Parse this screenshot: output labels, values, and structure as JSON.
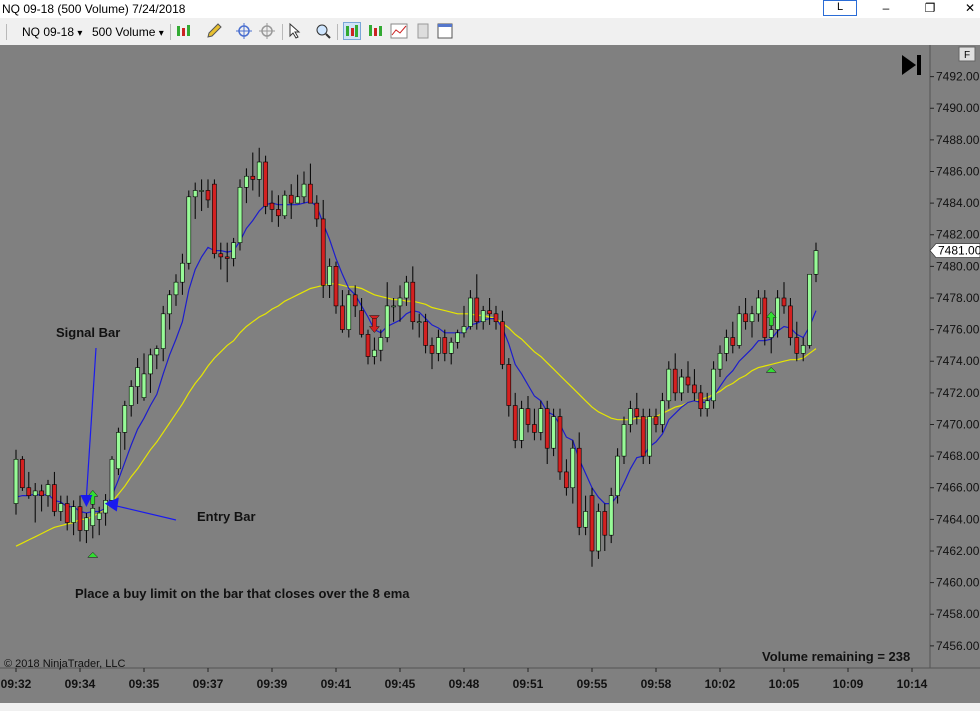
{
  "window": {
    "title": "NQ 09-18 (500 Volume)  7/24/2018",
    "link_label": "L",
    "minimize_glyph": "–",
    "maximize_glyph": "❐",
    "close_glyph": "✕"
  },
  "toolbar": {
    "instrument": "NQ 09-18",
    "interval": "500 Volume",
    "dropdown_glyph": "▾"
  },
  "chart_ui": {
    "f_label": "F",
    "copyright": "© 2018 NinjaTrader, LLC",
    "volume_remaining": "Volume remaining = 238",
    "colors": {
      "background": "#808080",
      "up_bar": "#98fb98",
      "down_bar": "#d42020",
      "ema_fast": "#1c1ccc",
      "ema_slow": "#e6e600",
      "annotation_arrow": "#1a1aee",
      "buy_marker": "#33dd33",
      "sell_marker": "#d42020"
    }
  },
  "chart_data": {
    "type": "candlestick",
    "instrument": "NQ 09-18",
    "interval": "500 Volume",
    "ylim": [
      7454.6,
      7494.0
    ],
    "y_ticks": [
      7456,
      7458,
      7460,
      7462,
      7464,
      7466,
      7468,
      7470,
      7472,
      7474,
      7476,
      7478,
      7480,
      7482,
      7484,
      7486,
      7488,
      7490,
      7492
    ],
    "y_tick_labels": [
      "7456.00",
      "7458.00",
      "7460.00",
      "7462.00",
      "7464.00",
      "7466.00",
      "7468.00",
      "7470.00",
      "7472.00",
      "7474.00",
      "7476.00",
      "7478.00",
      "7480.00",
      "7482.00",
      "7484.00",
      "7486.00",
      "7488.00",
      "7490.00",
      "7492.00"
    ],
    "last_price": 7481.0,
    "last_price_label": "7481.00",
    "x_tick_labels": [
      {
        "bar": 0,
        "label": "09:32"
      },
      {
        "bar": 10,
        "label": "09:34"
      },
      {
        "bar": 20,
        "label": "09:35"
      },
      {
        "bar": 30,
        "label": "09:37"
      },
      {
        "bar": 40,
        "label": "09:39"
      },
      {
        "bar": 50,
        "label": "09:41"
      },
      {
        "bar": 60,
        "label": "09:45"
      },
      {
        "bar": 70,
        "label": "09:48"
      },
      {
        "bar": 80,
        "label": "09:51"
      },
      {
        "bar": 90,
        "label": "09:55"
      },
      {
        "bar": 100,
        "label": "09:58"
      },
      {
        "bar": 110,
        "label": "10:02"
      },
      {
        "bar": 120,
        "label": "10:05"
      },
      {
        "bar": 130,
        "label": "10:09"
      },
      {
        "bar": 140,
        "label": "10:14"
      }
    ],
    "ohlc": [
      [
        7465.0,
        7468.4,
        7464.3,
        7467.8
      ],
      [
        7467.8,
        7468.0,
        7465.8,
        7466.0
      ],
      [
        7466.0,
        7467.0,
        7465.3,
        7465.5
      ],
      [
        7465.5,
        7466.3,
        7463.8,
        7465.8
      ],
      [
        7465.8,
        7466.2,
        7464.5,
        7465.5
      ],
      [
        7465.5,
        7466.5,
        7464.8,
        7466.2
      ],
      [
        7466.2,
        7467.0,
        7464.2,
        7464.5
      ],
      [
        7464.5,
        7465.5,
        7463.9,
        7465.0
      ],
      [
        7465.0,
        7465.5,
        7463.3,
        7463.8
      ],
      [
        7463.8,
        7465.2,
        7463.0,
        7464.8
      ],
      [
        7464.8,
        7465.5,
        7462.6,
        7463.3
      ],
      [
        7463.3,
        7464.4,
        7462.5,
        7464.1
      ],
      [
        7463.6,
        7465.0,
        7462.8,
        7464.7
      ],
      [
        7464.0,
        7464.8,
        7463.0,
        7464.4
      ],
      [
        7464.4,
        7465.6,
        7463.6,
        7465.2
      ],
      [
        7465.2,
        7468.0,
        7465.2,
        7467.8
      ],
      [
        7467.2,
        7469.8,
        7466.8,
        7469.5
      ],
      [
        7469.5,
        7471.5,
        7468.4,
        7471.2
      ],
      [
        7471.2,
        7472.8,
        7470.5,
        7472.4
      ],
      [
        7472.4,
        7474.2,
        7471.3,
        7473.6
      ],
      [
        7471.7,
        7474.5,
        7471.5,
        7473.2
      ],
      [
        7473.2,
        7474.8,
        7472.0,
        7474.4
      ],
      [
        7474.4,
        7475.0,
        7473.5,
        7474.8
      ],
      [
        7474.8,
        7477.5,
        7474.0,
        7477.0
      ],
      [
        7477.0,
        7478.5,
        7476.0,
        7478.2
      ],
      [
        7478.2,
        7479.5,
        7477.5,
        7479.0
      ],
      [
        7479.0,
        7480.8,
        7478.2,
        7480.2
      ],
      [
        7480.2,
        7484.8,
        7479.8,
        7484.4
      ],
      [
        7484.4,
        7485.3,
        7483.0,
        7484.8
      ],
      [
        7484.8,
        7485.5,
        7483.5,
        7484.8
      ],
      [
        7484.8,
        7485.5,
        7483.7,
        7484.2
      ],
      [
        7485.2,
        7485.5,
        7480.5,
        7480.8
      ],
      [
        7480.8,
        7481.5,
        7479.8,
        7480.6
      ],
      [
        7480.6,
        7481.5,
        7479.0,
        7480.5
      ],
      [
        7480.5,
        7481.8,
        7480.0,
        7481.5
      ],
      [
        7481.5,
        7485.5,
        7481.0,
        7485.0
      ],
      [
        7485.0,
        7486.2,
        7484.0,
        7485.7
      ],
      [
        7485.7,
        7487.2,
        7484.8,
        7485.5
      ],
      [
        7485.5,
        7487.5,
        7484.4,
        7486.6
      ],
      [
        7486.6,
        7487.0,
        7483.3,
        7483.8
      ],
      [
        7484.0,
        7484.8,
        7482.8,
        7483.6
      ],
      [
        7483.6,
        7484.5,
        7482.5,
        7483.2
      ],
      [
        7483.2,
        7484.8,
        7483.0,
        7484.5
      ],
      [
        7484.5,
        7485.2,
        7483.0,
        7484.0
      ],
      [
        7484.0,
        7485.8,
        7484.0,
        7484.4
      ],
      [
        7484.4,
        7486.0,
        7484.0,
        7485.2
      ],
      [
        7485.2,
        7486.5,
        7484.5,
        7484.0
      ],
      [
        7484.0,
        7484.5,
        7482.5,
        7483.0
      ],
      [
        7483.0,
        7484.2,
        7478.0,
        7478.8
      ],
      [
        7478.8,
        7480.5,
        7478.0,
        7480.0
      ],
      [
        7480.0,
        7480.3,
        7477.0,
        7477.5
      ],
      [
        7477.5,
        7478.5,
        7475.8,
        7476.0
      ],
      [
        7476.0,
        7478.5,
        7475.5,
        7478.2
      ],
      [
        7478.2,
        7478.8,
        7476.8,
        7477.5
      ],
      [
        7477.2,
        7478.0,
        7475.5,
        7475.7
      ],
      [
        7475.7,
        7476.0,
        7473.8,
        7474.3
      ],
      [
        7474.3,
        7475.5,
        7473.8,
        7474.7
      ],
      [
        7474.7,
        7476.0,
        7474.0,
        7475.5
      ],
      [
        7475.5,
        7479.0,
        7475.2,
        7477.5
      ],
      [
        7477.5,
        7478.0,
        7476.5,
        7477.5
      ],
      [
        7477.5,
        7478.8,
        7476.5,
        7478.0
      ],
      [
        7478.0,
        7479.4,
        7477.5,
        7479.0
      ],
      [
        7479.0,
        7480.0,
        7476.0,
        7476.5
      ],
      [
        7476.5,
        7477.0,
        7475.5,
        7476.5
      ],
      [
        7476.5,
        7477.0,
        7474.5,
        7475.0
      ],
      [
        7475.0,
        7475.5,
        7473.5,
        7474.5
      ],
      [
        7474.5,
        7476.0,
        7474.0,
        7475.5
      ],
      [
        7475.5,
        7476.0,
        7474.0,
        7474.5
      ],
      [
        7474.5,
        7475.5,
        7473.8,
        7475.2
      ],
      [
        7475.2,
        7476.0,
        7474.8,
        7475.8
      ],
      [
        7475.8,
        7477.5,
        7475.5,
        7476.2
      ],
      [
        7476.2,
        7478.5,
        7476.0,
        7478.0
      ],
      [
        7478.0,
        7479.5,
        7476.0,
        7476.5
      ],
      [
        7476.5,
        7477.5,
        7476.0,
        7477.2
      ],
      [
        7477.2,
        7478.0,
        7476.3,
        7477.0
      ],
      [
        7477.0,
        7477.5,
        7476.0,
        7476.5
      ],
      [
        7476.5,
        7477.2,
        7473.5,
        7473.8
      ],
      [
        7473.8,
        7474.2,
        7470.5,
        7471.2
      ],
      [
        7471.2,
        7472.0,
        7468.5,
        7469.0
      ],
      [
        7469.0,
        7471.5,
        7468.5,
        7471.0
      ],
      [
        7471.0,
        7471.8,
        7469.5,
        7470.0
      ],
      [
        7470.0,
        7471.0,
        7469.0,
        7469.5
      ],
      [
        7469.5,
        7471.5,
        7469.0,
        7471.0
      ],
      [
        7471.0,
        7471.5,
        7467.5,
        7468.5
      ],
      [
        7468.5,
        7471.0,
        7468.0,
        7470.5
      ],
      [
        7470.5,
        7471.0,
        7466.5,
        7467.0
      ],
      [
        7467.0,
        7467.8,
        7465.5,
        7466.0
      ],
      [
        7466.0,
        7469.0,
        7465.0,
        7468.5
      ],
      [
        7468.5,
        7469.5,
        7463.0,
        7463.5
      ],
      [
        7463.5,
        7465.5,
        7463.0,
        7464.5
      ],
      [
        7465.5,
        7466.0,
        7461.0,
        7462.0
      ],
      [
        7462.0,
        7465.0,
        7461.5,
        7464.5
      ],
      [
        7464.5,
        7465.0,
        7462.0,
        7463.0
      ],
      [
        7463.0,
        7466.0,
        7462.5,
        7465.5
      ],
      [
        7465.5,
        7468.5,
        7465.0,
        7468.0
      ],
      [
        7468.0,
        7470.5,
        7467.5,
        7470.0
      ],
      [
        7470.0,
        7471.5,
        7469.5,
        7471.0
      ],
      [
        7471.0,
        7472.0,
        7470.0,
        7470.5
      ],
      [
        7470.5,
        7471.0,
        7467.5,
        7468.0
      ],
      [
        7468.0,
        7471.0,
        7467.5,
        7470.5
      ],
      [
        7470.5,
        7471.0,
        7469.5,
        7470.0
      ],
      [
        7470.0,
        7472.0,
        7469.5,
        7471.5
      ],
      [
        7471.5,
        7474.0,
        7471.0,
        7473.5
      ],
      [
        7473.5,
        7474.5,
        7471.5,
        7472.0
      ],
      [
        7472.0,
        7473.5,
        7471.5,
        7473.0
      ],
      [
        7473.0,
        7474.0,
        7472.0,
        7472.5
      ],
      [
        7472.5,
        7473.5,
        7471.5,
        7472.0
      ],
      [
        7472.0,
        7472.5,
        7470.5,
        7471.0
      ],
      [
        7471.0,
        7472.0,
        7470.5,
        7471.5
      ],
      [
        7471.5,
        7474.0,
        7471.0,
        7473.5
      ],
      [
        7473.5,
        7475.0,
        7473.0,
        7474.5
      ],
      [
        7474.5,
        7476.0,
        7474.0,
        7475.5
      ],
      [
        7475.5,
        7476.5,
        7474.5,
        7475.0
      ],
      [
        7475.0,
        7477.5,
        7474.8,
        7477.0
      ],
      [
        7477.0,
        7478.0,
        7476.0,
        7476.5
      ],
      [
        7476.5,
        7477.5,
        7475.5,
        7477.0
      ],
      [
        7477.0,
        7478.5,
        7476.5,
        7478.0
      ],
      [
        7478.0,
        7478.5,
        7475.0,
        7475.5
      ],
      [
        7475.5,
        7476.5,
        7474.5,
        7476.0
      ],
      [
        7476.0,
        7478.5,
        7475.5,
        7478.0
      ],
      [
        7478.0,
        7479.0,
        7477.0,
        7477.5
      ],
      [
        7477.5,
        7478.0,
        7475.0,
        7475.5
      ],
      [
        7475.5,
        7476.5,
        7474.0,
        7474.5
      ],
      [
        7474.5,
        7475.5,
        7474.0,
        7475.0
      ],
      [
        7475.0,
        7479.0,
        7474.8,
        7479.5
      ],
      [
        7479.5,
        7481.5,
        7479.0,
        7481.0
      ]
    ],
    "ema_fast": [
      7465.4,
      7465.5,
      7465.5,
      7465.6,
      7465.5,
      7465.6,
      7465.2,
      7465.1,
      7464.8,
      7464.8,
      7464.5,
      7464.4,
      7464.5,
      7464.5,
      7464.7,
      7465.5,
      7466.5,
      7467.6,
      7468.7,
      7469.7,
      7470.4,
      7471.2,
      7471.9,
      7473.2,
      7474.4,
      7475.4,
      7476.5,
      7478.5,
      7479.8,
      7480.6,
      7481.2,
      7481.0,
      7481.0,
      7480.9,
      7481.0,
      7481.6,
      7482.4,
      7482.9,
      7483.5,
      7483.9,
      7484.0,
      7483.9,
      7483.9,
      7483.9,
      7483.9,
      7484.0,
      7484.1,
      7483.8,
      7482.7,
      7481.7,
      7480.5,
      7479.5,
      7478.6,
      7478.2,
      7477.5,
      7476.8,
      7476.0,
      7475.8,
      7476.2,
      7476.4,
      7476.6,
      7477.0,
      7477.2,
      7477.1,
      7476.7,
      7476.3,
      7476.1,
      7475.8,
      7475.8,
      7475.8,
      7475.8,
      7476.3,
      7476.4,
      7476.6,
      7476.7,
      7476.7,
      7476.1,
      7475.1,
      7473.8,
      7473.2,
      7472.5,
      7471.8,
      7471.5,
      7470.8,
      7470.6,
      7470.0,
      7469.2,
      7469.0,
      7467.8,
      7466.9,
      7466.0,
      7465.4,
      7465.0,
      7465.0,
      7465.5,
      7466.3,
      7467.2,
      7467.9,
      7468.0,
      7468.6,
      7468.9,
      7469.4,
      7470.3,
      7470.7,
      7471.1,
      7471.4,
      7471.5,
      7471.4,
      7471.4,
      7471.8,
      7472.4,
      7473.0,
      7473.4,
      7474.0,
      7474.4,
      7474.8,
      7475.3,
      7475.3,
      7475.4,
      7475.9,
      7476.2,
      7476.1,
      7475.7,
      7475.5,
      7476.2,
      7477.2
    ],
    "ema_slow": [
      7462.3,
      7462.5,
      7462.7,
      7462.9,
      7463.1,
      7463.3,
      7463.5,
      7463.6,
      7463.7,
      7463.8,
      7464.0,
      7464.0,
      7464.2,
      7464.4,
      7464.7,
      7465.1,
      7465.6,
      7466.1,
      7466.7,
      7467.2,
      7467.8,
      7468.4,
      7468.9,
      7469.5,
      7470.1,
      7470.7,
      7471.3,
      7472.0,
      7472.6,
      7473.1,
      7473.7,
      7474.2,
      7474.6,
      7475.0,
      7475.3,
      7475.8,
      7476.2,
      7476.5,
      7476.8,
      7477.0,
      7477.3,
      7477.5,
      7477.8,
      7478.0,
      7478.2,
      7478.4,
      7478.6,
      7478.7,
      7478.8,
      7478.9,
      7478.9,
      7478.8,
      7478.7,
      7478.7,
      7478.6,
      7478.4,
      7478.2,
      7478.1,
      7478.0,
      7477.9,
      7477.9,
      7477.8,
      7477.8,
      7477.7,
      7477.6,
      7477.4,
      7477.3,
      7477.2,
      7477.1,
      7477.0,
      7477.0,
      7477.0,
      7476.9,
      7476.9,
      7476.8,
      7476.7,
      7476.4,
      7476.1,
      7475.7,
      7475.4,
      7475.0,
      7474.6,
      7474.3,
      7473.9,
      7473.5,
      7473.1,
      7472.7,
      7472.3,
      7471.9,
      7471.5,
      7471.1,
      7470.8,
      7470.6,
      7470.4,
      7470.3,
      7470.3,
      7470.3,
      7470.4,
      7470.4,
      7470.4,
      7470.5,
      7470.7,
      7470.9,
      7471.1,
      7471.2,
      7471.4,
      7471.5,
      7471.6,
      7471.7,
      7471.9,
      7472.1,
      7472.4,
      7472.6,
      7472.9,
      7473.1,
      7473.4,
      7473.6,
      7473.7,
      7473.8,
      7473.9,
      7474.0,
      7474.1,
      7474.1,
      7474.2,
      7474.5,
      7474.8
    ],
    "annotations": [
      {
        "text": "Signal Bar",
        "bar": 11
      },
      {
        "text": "Entry Bar",
        "bar": 12
      },
      {
        "text": "Place a buy limit on the bar that closes over the 8 ema"
      }
    ],
    "signals": [
      {
        "type": "buy",
        "bar": 12
      },
      {
        "type": "sell",
        "bar": 56
      },
      {
        "type": "buy",
        "bar": 118
      }
    ]
  }
}
